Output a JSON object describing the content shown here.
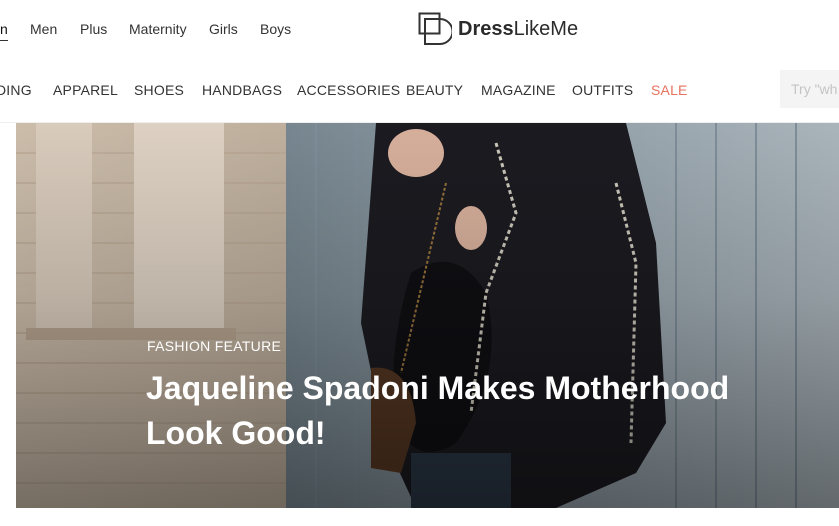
{
  "segments": [
    {
      "label": "n",
      "active": true
    },
    {
      "label": "Men"
    },
    {
      "label": "Plus"
    },
    {
      "label": "Maternity"
    },
    {
      "label": "Girls"
    },
    {
      "label": "Boys"
    }
  ],
  "logo": {
    "bold": "Dress",
    "light": "LikeMe"
  },
  "categories": [
    {
      "label": "DING"
    },
    {
      "label": "APPAREL"
    },
    {
      "label": "SHOES"
    },
    {
      "label": "HANDBAGS"
    },
    {
      "label": "ACCESSORIES"
    },
    {
      "label": "BEAUTY"
    },
    {
      "label": "MAGAZINE"
    },
    {
      "label": "OUTFITS"
    },
    {
      "label": "SALE"
    }
  ],
  "search": {
    "placeholder": "Try \"wh"
  },
  "hero": {
    "kicker": "FASHION FEATURE",
    "title": "Jaqueline Spadoni Makes Motherhood Look Good!"
  },
  "colors": {
    "sale": "#e8715f",
    "text": "#333333"
  }
}
